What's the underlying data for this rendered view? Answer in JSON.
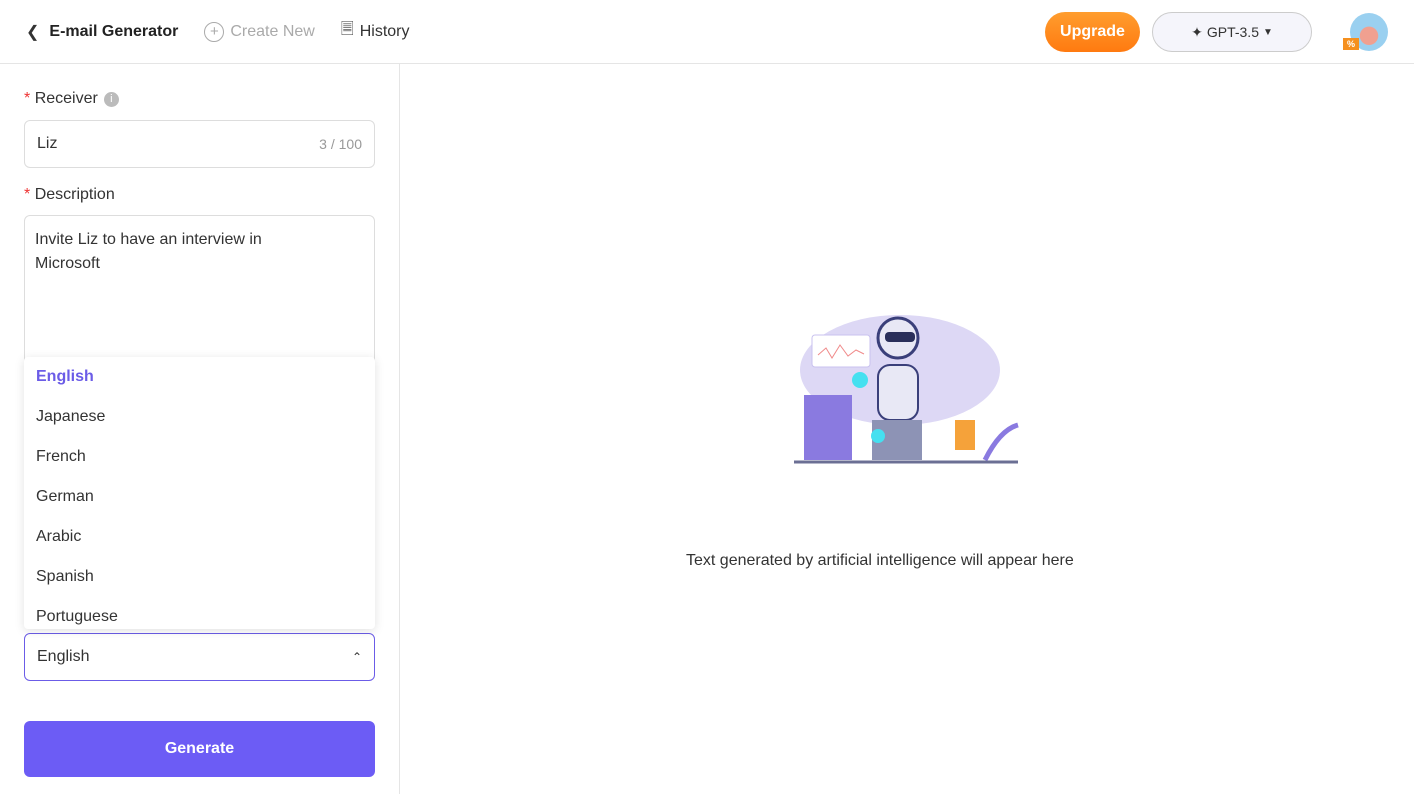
{
  "header": {
    "title": "E-mail Generator",
    "create_new": "Create New",
    "history": "History",
    "upgrade": "Upgrade",
    "model": "GPT-3.5",
    "avatar_badge": "%"
  },
  "form": {
    "receiver_label": "Receiver",
    "receiver_value": "Liz",
    "receiver_count": "3 / 100",
    "description_label": "Description",
    "description_value": "Invite Liz to have an interview in Microsoft",
    "language_options": [
      "English",
      "Japanese",
      "French",
      "German",
      "Arabic",
      "Spanish",
      "Portuguese"
    ],
    "language_selected": "English",
    "generate": "Generate"
  },
  "output": {
    "placeholder": "Text generated by artificial intelligence will appear here"
  },
  "colors": {
    "accent": "#6c5cf5",
    "upgrade": "#ff8a1e"
  }
}
